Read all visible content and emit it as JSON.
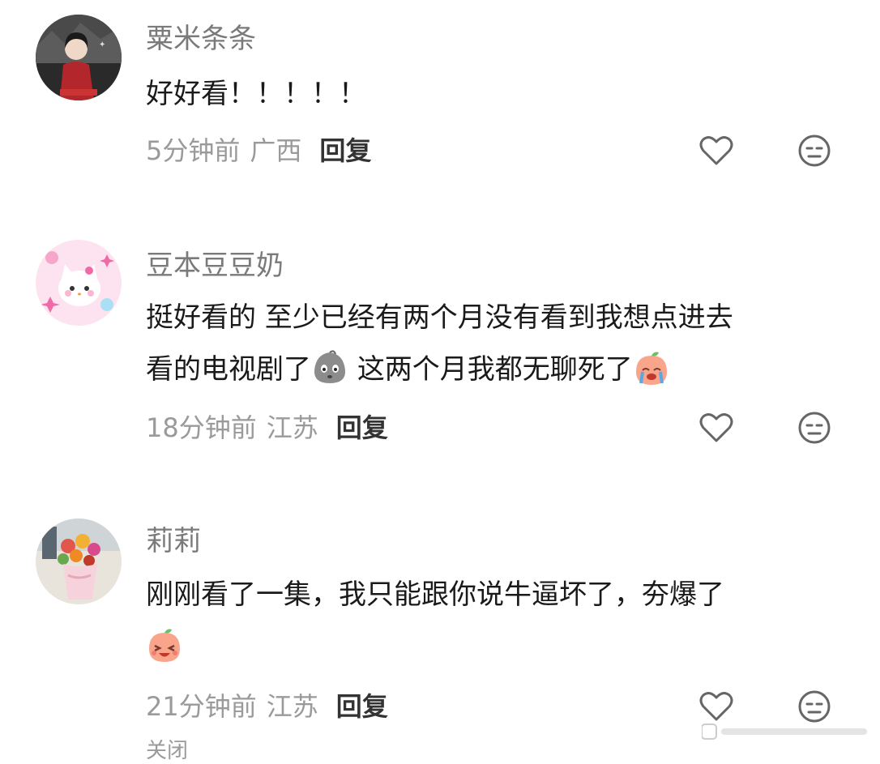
{
  "comments": [
    {
      "username": "粟米条条",
      "text": "好好看！！！！！",
      "time": "5分钟前",
      "location": "广西",
      "reply": "回复",
      "avatar": "drama-poster-avatar"
    },
    {
      "username": "豆本豆豆奶",
      "text_line1": "挺好看的 至少已经有两个月没有看到我想点进去",
      "text_line2a": "看的电视剧了",
      "text_line2b": "这两个月我都无聊死了",
      "time": "18分钟前",
      "location": "江苏",
      "reply": "回复",
      "emoji_1": "speechless-face-emoji",
      "emoji_2": "crying-peach-emoji",
      "avatar": "pink-kitty-avatar"
    },
    {
      "username": "莉莉",
      "text": "刚刚看了一集，我只能跟你说牛逼坏了，夯爆了",
      "time": "21分钟前",
      "location": "江苏",
      "reply": "回复",
      "emoji": "laughing-peach-emoji",
      "avatar": "flower-bouquet-avatar"
    }
  ],
  "icons": {
    "like": "heart-outline-icon",
    "dislike": "meh-face-icon"
  },
  "footer": {
    "partial": "关闭"
  },
  "colors": {
    "text": "#1a1a1a",
    "username": "#7a7a7a",
    "meta": "#9a9a9a"
  }
}
